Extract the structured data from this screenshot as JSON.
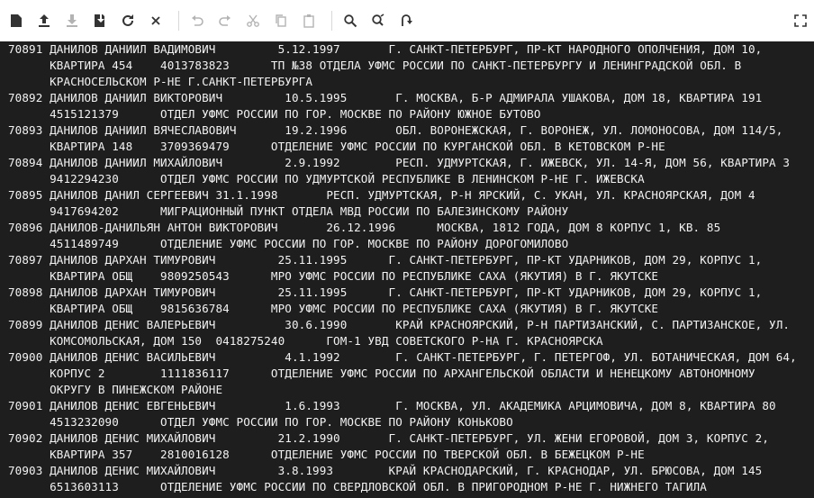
{
  "toolbar": {
    "buttons": [
      {
        "name": "new-file-icon"
      },
      {
        "name": "upload-icon"
      },
      {
        "name": "download-icon"
      },
      {
        "name": "file-download-icon"
      },
      {
        "name": "refresh-icon"
      },
      {
        "name": "close-icon"
      },
      {
        "name": "undo-icon"
      },
      {
        "name": "redo-icon"
      },
      {
        "name": "cut-icon"
      },
      {
        "name": "copy-icon"
      },
      {
        "name": "paste-icon"
      },
      {
        "name": "search-icon"
      },
      {
        "name": "replace-icon"
      },
      {
        "name": "goto-line-icon"
      },
      {
        "name": "fullscreen-icon"
      }
    ]
  },
  "content": {
    "lines": [
      "70891 ДАНИЛОВ ДАНИИЛ ВАДИМОВИЧ         5.12.1997       Г. САНКТ-ПЕТЕРБУРГ, ПР-КТ НАРОДНОГО ОПОЛЧЕНИЯ, ДОМ 10,",
      "      КВАРТИРА 454    4013783823      ТП №38 ОТДЕЛА УФМС РОССИИ ПО САНКТ-ПЕТЕРБУРГУ И ЛЕНИНГРАДСКОЙ ОБЛ. В",
      "      КРАСНОСЕЛЬСКОМ Р-НЕ Г.САНКТ-ПЕТЕРБУРГА",
      "70892 ДАНИЛОВ ДАНИИЛ ВИКТОРОВИЧ         10.5.1995       Г. МОСКВА, Б-Р АДМИРАЛА УШАКОВА, ДОМ 18, КВАРТИРА 191",
      "      4515121379      ОТДЕЛ УФМС РОССИИ ПО ГОР. МОСКВЕ ПО РАЙОНУ ЮЖНОЕ БУТОВО",
      "70893 ДАНИЛОВ ДАНИИЛ ВЯЧЕСЛАВОВИЧ       19.2.1996       ОБЛ. ВОРОНЕЖСКАЯ, Г. ВОРОНЕЖ, УЛ. ЛОМОНОСОВА, ДОМ 114/5,",
      "      КВАРТИРА 148    3709369479      ОТДЕЛЕНИЕ УФМС РОССИИ ПО КУРГАНСКОЙ ОБЛ. В КЕТОВСКОМ Р-НЕ",
      "70894 ДАНИЛОВ ДАНИИЛ МИХАЙЛОВИЧ         2.9.1992        РЕСП. УДМУРТСКАЯ, Г. ИЖЕВСК, УЛ. 14-Я, ДОМ 56, КВАРТИРА 3",
      "      9412294230      ОТДЕЛ УФМС РОССИИ ПО УДМУРТСКОЙ РЕСПУБЛИКЕ В ЛЕНИНСКОМ Р-НЕ Г. ИЖЕВСКА",
      "70895 ДАНИЛОВ ДАНИЛ СЕРГЕЕВИЧ 31.1.1998       РЕСП. УДМУРТСКАЯ, Р-Н ЯРСКИЙ, С. УКАН, УЛ. КРАСНОЯРСКАЯ, ДОМ 4",
      "      9417694202      МИГРАЦИОННЫЙ ПУНКТ ОТДЕЛА МВД РОССИИ ПО БАЛЕЗИНСКОМУ РАЙОНУ",
      "70896 ДАНИЛОВ-ДАНИЛЬЯН АНТОН ВИКТОРОВИЧ       26.12.1996      МОСКВА, 1812 ГОДА, ДОМ 8 КОРПУС 1, КВ. 85",
      "      4511489749      ОТДЕЛЕНИЕ УФМС РОССИИ ПО ГОР. МОСКВЕ ПО РАЙОНУ ДОРОГОМИЛОВО",
      "70897 ДАНИЛОВ ДАРХАН ТИМУРОВИЧ         25.11.1995      Г. САНКТ-ПЕТЕРБУРГ, ПР-КТ УДАРНИКОВ, ДОМ 29, КОРПУС 1,",
      "      КВАРТИРА ОБЩ    9809250543      МРО УФМС РОССИИ ПО РЕСПУБЛИКЕ САХА (ЯКУТИЯ) В Г. ЯКУТСКЕ",
      "70898 ДАНИЛОВ ДАРХАН ТИМУРОВИЧ         25.11.1995      Г. САНКТ-ПЕТЕРБУРГ, ПР-КТ УДАРНИКОВ, ДОМ 29, КОРПУС 1,",
      "      КВАРТИРА ОБЩ    9815636784      МРО УФМС РОССИИ ПО РЕСПУБЛИКЕ САХА (ЯКУТИЯ) В Г. ЯКУТСКЕ",
      "70899 ДАНИЛОВ ДЕНИС ВАЛЕРЬЕВИЧ          30.6.1990       КРАЙ КРАСНОЯРСКИЙ, Р-Н ПАРТИЗАНСКИЙ, С. ПАРТИЗАНСКОЕ, УЛ.",
      "      КОМСОМОЛЬСКАЯ, ДОМ 150  0418275240      ГОМ-1 УВД СОВЕТСКОГО Р-НА Г. КРАСНОЯРСКА",
      "70900 ДАНИЛОВ ДЕНИС ВАСИЛЬЕВИЧ          4.1.1992        Г. САНКТ-ПЕТЕРБУРГ, Г. ПЕТЕРГОФ, УЛ. БОТАНИЧЕСКАЯ, ДОМ 64,",
      "      КОРПУС 2        1111836117      ОТДЕЛЕНИЕ УФМС РОССИИ ПО АРХАНГЕЛЬСКОЙ ОБЛАСТИ И НЕНЕЦКОМУ АВТОНОМНОМУ",
      "      ОКРУГУ В ПИНЕЖСКОМ РАЙОНЕ",
      "70901 ДАНИЛОВ ДЕНИС ЕВГЕНЬЕВИЧ          1.6.1993        Г. МОСКВА, УЛ. АКАДЕМИКА АРЦИМОВИЧА, ДОМ 8, КВАРТИРА 80",
      "      4513232090      ОТДЕЛ УФМС РОССИИ ПО ГОР. МОСКВЕ ПО РАЙОНУ КОНЬКОВО",
      "70902 ДАНИЛОВ ДЕНИС МИХАЙЛОВИЧ         21.2.1990       Г. САНКТ-ПЕТЕРБУРГ, УЛ. ЖЕНИ ЕГОРОВОЙ, ДОМ 3, КОРПУС 2,",
      "      КВАРТИРА 357    2810016128      ОТДЕЛЕНИЕ УФМС РОССИИ ПО ТВЕРСКОЙ ОБЛ. В БЕЖЕЦКОМ Р-НЕ",
      "70903 ДАНИЛОВ ДЕНИС МИХАЙЛОВИЧ         3.8.1993        КРАЙ КРАСНОДАРСКИЙ, Г. КРАСНОДАР, УЛ. БРЮСОВА, ДОМ 145",
      "      6513603113      ОТДЕЛЕНИЕ УФМС РОССИИ ПО СВЕРДЛОВСКОЙ ОБЛ. В ПРИГОРОДНОМ Р-НЕ Г. НИЖНЕГО ТАГИЛА"
    ]
  }
}
